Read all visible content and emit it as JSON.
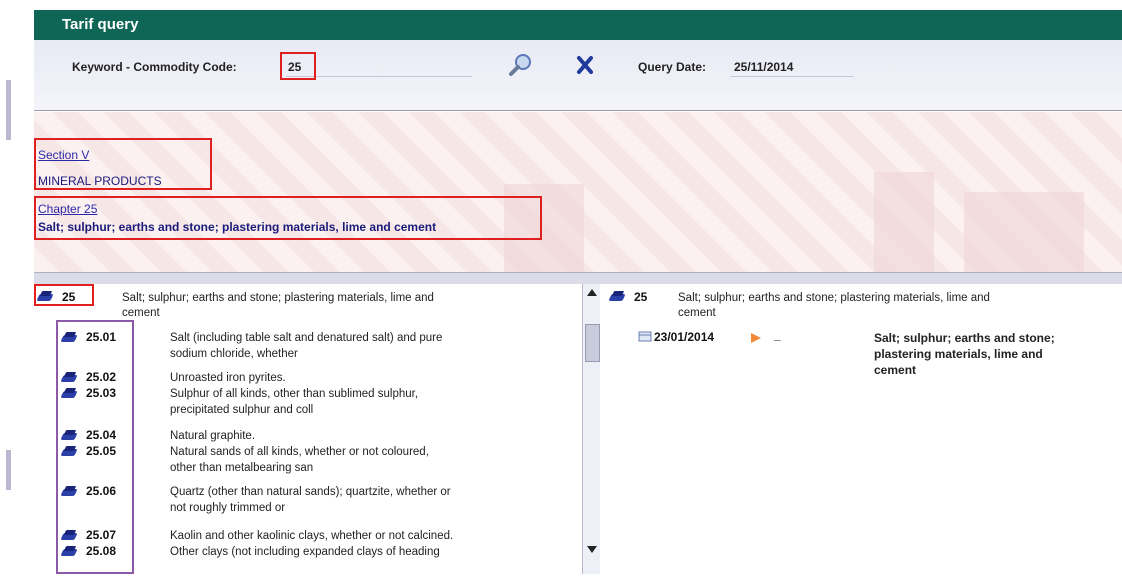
{
  "window": {
    "title": "Tarif query"
  },
  "query": {
    "keyword_label": "Keyword - Commodity Code:",
    "keyword_value": "25",
    "date_label": "Query Date:",
    "date_value": "25/11/2014"
  },
  "section": {
    "link": "Section V",
    "name": "MINERAL PRODUCTS"
  },
  "chapter": {
    "link": "Chapter 25",
    "desc": "Salt; sulphur; earths and stone; plastering materials, lime and cement"
  },
  "tree": {
    "root": {
      "code": "25",
      "desc_line1": "Salt; sulphur; earths and stone; plastering materials, lime and",
      "desc_line2": "cement"
    },
    "items": [
      {
        "code": "25.01",
        "desc_line1": "Salt (including table salt and denatured salt) and pure",
        "desc_line2": "sodium chloride, whether"
      },
      {
        "code": "25.02",
        "desc_line1": "Unroasted iron pyrites.",
        "desc_line2": ""
      },
      {
        "code": "25.03",
        "desc_line1": "Sulphur of all kinds, other than sublimed sulphur,",
        "desc_line2": "precipitated sulphur and coll"
      },
      {
        "code": "25.04",
        "desc_line1": "Natural graphite.",
        "desc_line2": ""
      },
      {
        "code": "25.05",
        "desc_line1": "Natural sands of all kinds, whether or not coloured,",
        "desc_line2": "other than metalbearing san"
      },
      {
        "code": "25.06",
        "desc_line1": "Quartz (other than natural sands); quartzite, whether or",
        "desc_line2": "not roughly trimmed or"
      },
      {
        "code": "25.07",
        "desc_line1": "Kaolin and other kaolinic clays, whether or not calcined.",
        "desc_line2": ""
      },
      {
        "code": "25.08",
        "desc_line1": "Other clays (not including expanded clays of heading",
        "desc_line2": ""
      }
    ]
  },
  "detail": {
    "code": "25",
    "desc_line1": "Salt; sulphur; earths and stone; plastering materials, lime and",
    "desc_line2": "cement",
    "date": "23/01/2014",
    "dash": "_",
    "bold_desc_line1": "Salt; sulphur; earths and stone;",
    "bold_desc_line2": "plastering materials, lime and",
    "bold_desc_line3": "cement"
  },
  "icons": {
    "search": "search-icon",
    "clear": "close-icon",
    "book": "book-icon",
    "calendar": "calendar-icon",
    "arrow": "play-arrow-icon"
  },
  "colors": {
    "titlebar": "#0f6656",
    "highlight": "#e0201e",
    "highlight_purple": "#8c5aa8",
    "link": "#2a2aa8"
  }
}
